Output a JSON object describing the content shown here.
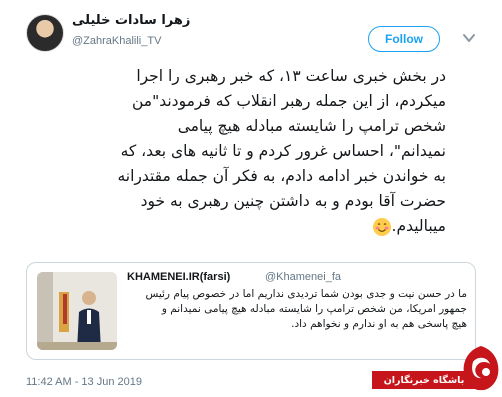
{
  "tweet": {
    "author_name": "زهرا سادات خلیلی",
    "author_handle": "@ZahraKhalili_TV",
    "follow_label": "Follow",
    "text": "در بخش خبری ساعت ۱۳، که خبر رهبری را اجرا\nمیکردم، از این جمله رهبر انقلاب که فرمودند\"من\nشخص ترامپ را شایسته مبادله هیچ پیامی\nنمیدانم\"، احساس غرور کردم و تا ثانیه های بعد، که\nبه خواندن خبر ادامه دادم، به فکر آن جمله مقتدرانه\nحضرت آقا بودم و به داشتن چنین رهبری به خود\nمیبالیدم.",
    "emoji": "smiling-face-with-blushing-icon",
    "timestamp": "11:42 AM - 13 Jun 2019"
  },
  "quoted_tweet": {
    "author_name": "KHAMENEI.IR(farsi)",
    "author_handle": "@Khamenei_fa",
    "text": "ما در حسن نیت و جدی بودن شما تردیدی نداریم اما در خصوص پیام رئیس\nجمهور امریکا، من شخص ترامپ را شایسته مبادله هیچ پیامی نمیدانم و\nهیچ پاسخی هم به او ندارم و نخواهم داد."
  },
  "watermark": {
    "label": "باشگاه خبرنگاران",
    "bar_color": "#c6161b"
  },
  "colors": {
    "accent": "#1da1f2",
    "secondary_text": "#657786",
    "border": "#ccd6dd"
  }
}
